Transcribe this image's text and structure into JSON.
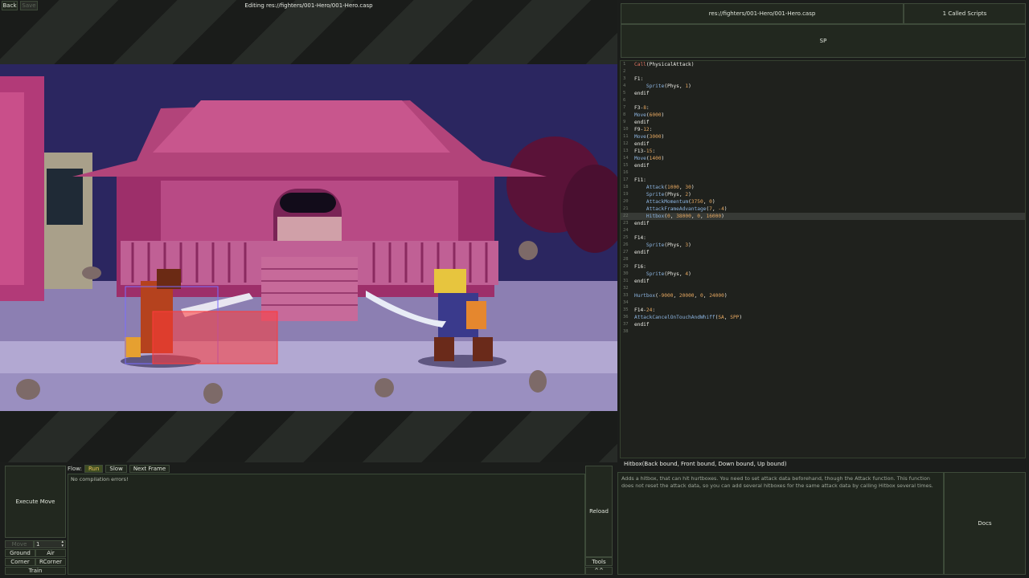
{
  "toolbar": {
    "back": "Back",
    "save": "Save",
    "editing_title": "Editing res://fighters/001-Hero/001-Hero.casp"
  },
  "tabs": {
    "file": "res://fighters/001-Hero/001-Hero.casp",
    "called_scripts": "1 Called Scripts"
  },
  "sp_label": "SP",
  "code_lines": [
    {
      "n": "1",
      "parts": [
        [
          "k-red",
          "Call"
        ],
        [
          "k-kw",
          "(PhysicalAttack)"
        ]
      ]
    },
    {
      "n": "2",
      "parts": []
    },
    {
      "n": "3",
      "parts": [
        [
          "k-kw",
          "F1:"
        ]
      ]
    },
    {
      "n": "4",
      "parts": [
        [
          "k-kw",
          "    "
        ],
        [
          "k-fn",
          "Sprite"
        ],
        [
          "k-kw",
          "(Phys, "
        ],
        [
          "k-num",
          "1"
        ],
        [
          "k-kw",
          ")"
        ]
      ]
    },
    {
      "n": "5",
      "parts": [
        [
          "k-kw",
          "endif"
        ]
      ]
    },
    {
      "n": "6",
      "parts": []
    },
    {
      "n": "7",
      "parts": [
        [
          "k-kw",
          "F3-"
        ],
        [
          "k-num",
          "8"
        ],
        [
          "k-kw",
          ":"
        ]
      ]
    },
    {
      "n": "8",
      "parts": [
        [
          "k-fn",
          "Move"
        ],
        [
          "k-kw",
          "("
        ],
        [
          "k-num",
          "6000"
        ],
        [
          "k-kw",
          ")"
        ]
      ]
    },
    {
      "n": "9",
      "parts": [
        [
          "k-kw",
          "endif"
        ]
      ]
    },
    {
      "n": "10",
      "parts": [
        [
          "k-kw",
          "F9-"
        ],
        [
          "k-num",
          "12"
        ],
        [
          "k-kw",
          ":"
        ]
      ]
    },
    {
      "n": "11",
      "parts": [
        [
          "k-fn",
          "Move"
        ],
        [
          "k-kw",
          "("
        ],
        [
          "k-num",
          "3000"
        ],
        [
          "k-kw",
          ")"
        ]
      ]
    },
    {
      "n": "12",
      "parts": [
        [
          "k-kw",
          "endif"
        ]
      ]
    },
    {
      "n": "13",
      "parts": [
        [
          "k-kw",
          "F13-"
        ],
        [
          "k-num",
          "15"
        ],
        [
          "k-kw",
          ":"
        ]
      ]
    },
    {
      "n": "14",
      "parts": [
        [
          "k-fn",
          "Move"
        ],
        [
          "k-kw",
          "("
        ],
        [
          "k-num",
          "1400"
        ],
        [
          "k-kw",
          ")"
        ]
      ]
    },
    {
      "n": "15",
      "parts": [
        [
          "k-kw",
          "endif"
        ]
      ]
    },
    {
      "n": "16",
      "parts": []
    },
    {
      "n": "17",
      "parts": [
        [
          "k-kw",
          "F11:"
        ]
      ]
    },
    {
      "n": "18",
      "parts": [
        [
          "k-kw",
          "    "
        ],
        [
          "k-fn",
          "Attack"
        ],
        [
          "k-kw",
          "("
        ],
        [
          "k-num",
          "1000"
        ],
        [
          "k-kw",
          ", "
        ],
        [
          "k-num",
          "30"
        ],
        [
          "k-kw",
          ")"
        ]
      ]
    },
    {
      "n": "19",
      "parts": [
        [
          "k-kw",
          "    "
        ],
        [
          "k-fn",
          "Sprite"
        ],
        [
          "k-kw",
          "(Phys, "
        ],
        [
          "k-num",
          "2"
        ],
        [
          "k-kw",
          ")"
        ]
      ]
    },
    {
      "n": "20",
      "parts": [
        [
          "k-kw",
          "    "
        ],
        [
          "k-fn",
          "AttackMomentum"
        ],
        [
          "k-kw",
          "("
        ],
        [
          "k-num",
          "3750"
        ],
        [
          "k-kw",
          ", "
        ],
        [
          "k-num",
          "0"
        ],
        [
          "k-kw",
          ")"
        ]
      ]
    },
    {
      "n": "21",
      "parts": [
        [
          "k-kw",
          "    "
        ],
        [
          "k-fn",
          "AttackFrameAdvantage"
        ],
        [
          "k-kw",
          "("
        ],
        [
          "k-num",
          "7"
        ],
        [
          "k-kw",
          ", "
        ],
        [
          "k-num",
          "-4"
        ],
        [
          "k-kw",
          ")"
        ]
      ]
    },
    {
      "n": "22",
      "hl": true,
      "parts": [
        [
          "k-kw",
          "    "
        ],
        [
          "k-fn",
          "Hitbox"
        ],
        [
          "k-kw",
          "("
        ],
        [
          "k-num",
          "0"
        ],
        [
          "k-kw",
          ", "
        ],
        [
          "k-num",
          "38000"
        ],
        [
          "k-kw",
          ", "
        ],
        [
          "k-num",
          "0"
        ],
        [
          "k-kw",
          ", "
        ],
        [
          "k-num",
          "16000"
        ],
        [
          "k-kw",
          ")"
        ]
      ]
    },
    {
      "n": "23",
      "parts": [
        [
          "k-kw",
          "endif"
        ]
      ]
    },
    {
      "n": "24",
      "parts": []
    },
    {
      "n": "25",
      "parts": [
        [
          "k-kw",
          "F14:"
        ]
      ]
    },
    {
      "n": "26",
      "parts": [
        [
          "k-kw",
          "    "
        ],
        [
          "k-fn",
          "Sprite"
        ],
        [
          "k-kw",
          "(Phys, "
        ],
        [
          "k-num",
          "3"
        ],
        [
          "k-kw",
          ")"
        ]
      ]
    },
    {
      "n": "27",
      "parts": [
        [
          "k-kw",
          "endif"
        ]
      ]
    },
    {
      "n": "28",
      "parts": []
    },
    {
      "n": "29",
      "parts": [
        [
          "k-kw",
          "F16:"
        ]
      ]
    },
    {
      "n": "30",
      "parts": [
        [
          "k-kw",
          "    "
        ],
        [
          "k-fn",
          "Sprite"
        ],
        [
          "k-kw",
          "(Phys, "
        ],
        [
          "k-num",
          "4"
        ],
        [
          "k-kw",
          ")"
        ]
      ]
    },
    {
      "n": "31",
      "parts": [
        [
          "k-kw",
          "endif"
        ]
      ]
    },
    {
      "n": "32",
      "parts": []
    },
    {
      "n": "33",
      "parts": [
        [
          "k-fn",
          "Hurtbox"
        ],
        [
          "k-kw",
          "("
        ],
        [
          "k-num",
          "-9000"
        ],
        [
          "k-kw",
          ", "
        ],
        [
          "k-num",
          "20000"
        ],
        [
          "k-kw",
          ", "
        ],
        [
          "k-num",
          "0"
        ],
        [
          "k-kw",
          ", "
        ],
        [
          "k-num",
          "24000"
        ],
        [
          "k-kw",
          ")"
        ]
      ]
    },
    {
      "n": "34",
      "parts": []
    },
    {
      "n": "35",
      "parts": [
        [
          "k-kw",
          "F14-"
        ],
        [
          "k-num",
          "24"
        ],
        [
          "k-kw",
          ":"
        ]
      ]
    },
    {
      "n": "36",
      "parts": [
        [
          "k-fn",
          "AttackCancelOnTouchAndWhiff"
        ],
        [
          "k-kw",
          "("
        ],
        [
          "k-num",
          "SA"
        ],
        [
          "k-kw",
          ", "
        ],
        [
          "k-num",
          "SPP"
        ],
        [
          "k-kw",
          ")"
        ]
      ]
    },
    {
      "n": "37",
      "parts": [
        [
          "k-kw",
          "endif"
        ]
      ]
    },
    {
      "n": "38",
      "parts": []
    }
  ],
  "signature": "Hitbox(Back bound, Front bound, Down bound, Up bound)",
  "doc_text": "Adds a hitbox, that can hit hurtboxes. You need to set attack data beforehand, though the Attack function. This function does not reset the attack data, so you can add several hitboxes for the same attack data by calling Hitbox several times.",
  "docs_button": "Docs",
  "execute_move": "Execute Move",
  "move_label": "Move",
  "move_value": "1",
  "buttons": {
    "ground": "Ground",
    "air": "Air",
    "corner": "Corner",
    "rcorner": "RCorner",
    "train": "Train"
  },
  "flow": {
    "label": "Flow:",
    "run": "Run",
    "slow": "Slow",
    "next_frame": "Next Frame"
  },
  "console_text": "No compilation errors!",
  "reload": "Reload",
  "tools": "Tools",
  "collapse": "^^",
  "colors": {
    "hitbox": "#ff3a3a",
    "hurtbox": "#7a6cff",
    "accent_run": "#e8c25a"
  }
}
